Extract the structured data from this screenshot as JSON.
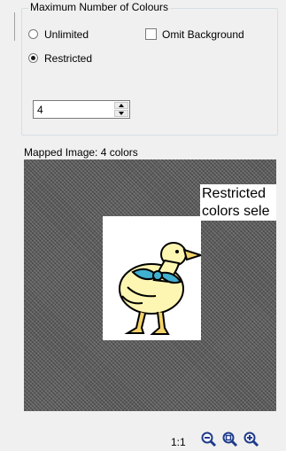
{
  "group": {
    "title": "Maximum Number of Colours",
    "unlimited_label": "Unlimited",
    "omit_background_label": "Omit Background",
    "restricted_label": "Restricted",
    "max_colors_value": "4",
    "selected_mode": "Restricted",
    "omit_background_checked": false
  },
  "preview": {
    "label": "Mapped Image: 4 colors",
    "tooltip_line1": "Restricted",
    "tooltip_line2": "colors sele",
    "zoom_level": "1:1"
  },
  "icons": [
    "zoom-out-icon",
    "zoom-fit-icon",
    "zoom-in-icon"
  ],
  "colors": {
    "background": "#f0f0f0",
    "canvas_hatch": "#5c5c5c",
    "duck_body": "#fdf6b2",
    "duck_bow": "#40b0d0",
    "duck_beak": "#f4d36a",
    "zoom_icon": "#1f3b8a"
  }
}
